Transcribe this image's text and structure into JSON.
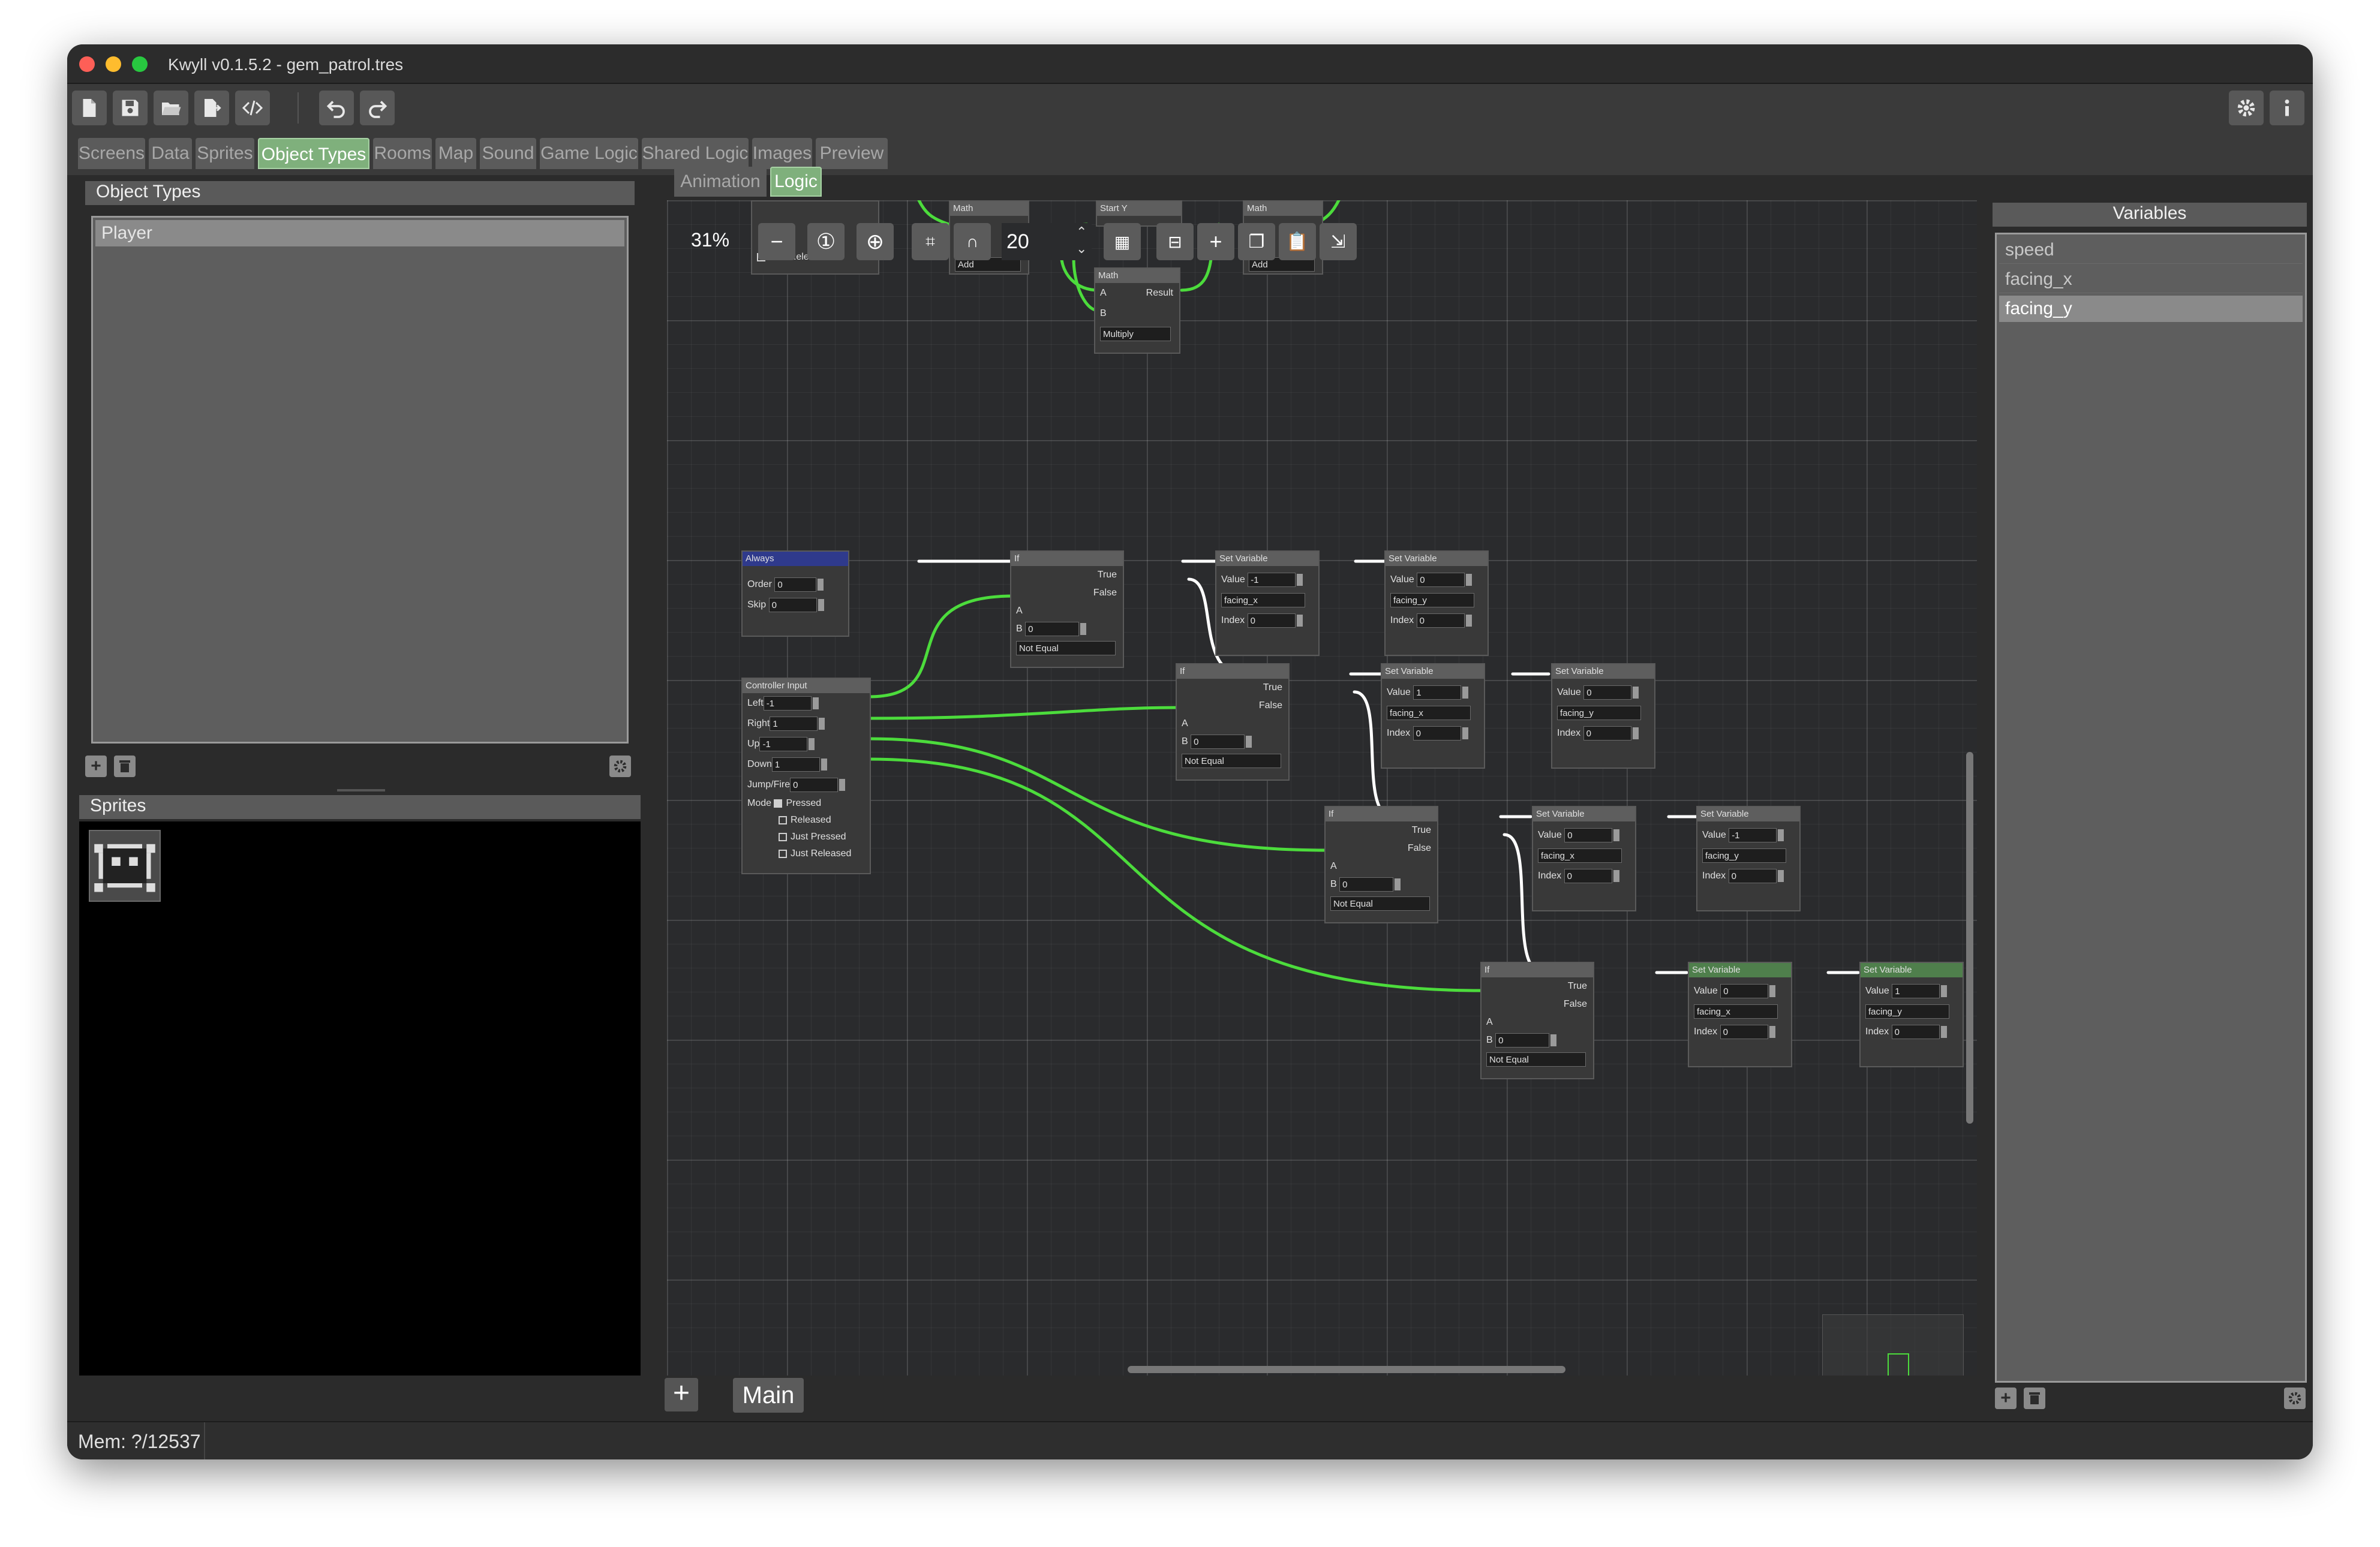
{
  "window": {
    "title": "Kwyll v0.1.5.2 - gem_patrol.tres"
  },
  "toolbar": {
    "left_buttons": [
      "new-file-icon",
      "save-icon",
      "open-folder-icon",
      "export-icon",
      "code-icon",
      "undo-icon",
      "redo-icon"
    ],
    "right_buttons": [
      "gear-icon",
      "info-icon"
    ]
  },
  "tabs": [
    "Screens",
    "Data",
    "Sprites",
    "Object Types",
    "Rooms",
    "Map",
    "Sound",
    "Game Logic",
    "Shared Logic",
    "Images",
    "Preview"
  ],
  "active_tab": "Object Types",
  "subtabs": [
    "Animation",
    "Logic"
  ],
  "active_subtab": "Logic",
  "left": {
    "object_types_header": "Object Types",
    "object_types": [
      "Player"
    ],
    "sprites_header": "Sprites"
  },
  "graph": {
    "zoom": "31%",
    "snap_value": "20",
    "bottom_tab": "Main",
    "add_label": "+",
    "nodes": {
      "top_cut": {
        "title": "Math",
        "math2": "Math",
        "start_y": "Start Y",
        "add1": "Add",
        "add2": "Add",
        "just_released": "Just Released",
        "mult_title": "Math",
        "a": "A",
        "b": "B",
        "result": "Result",
        "op": "Multiply"
      },
      "always": {
        "title": "Always",
        "order_label": "Order",
        "order": "0",
        "skip_label": "Skip",
        "skip": "0"
      },
      "controller": {
        "title": "Controller Input",
        "left_label": "Left",
        "left": "-1",
        "right_label": "Right",
        "right": "1",
        "up_label": "Up",
        "up": "-1",
        "down_label": "Down",
        "down": "1",
        "jump_label": "Jump/Fire",
        "jump": "0",
        "mode_label": "Mode",
        "pressed": "Pressed",
        "released": "Released",
        "just_pressed": "Just Pressed",
        "just_released": "Just Released"
      },
      "if_common": {
        "title": "If",
        "true": "True",
        "false": "False",
        "a": "A",
        "b": "B",
        "op": "Not Equal",
        "b_val": "0"
      },
      "setvar_common": {
        "title": "Set Variable",
        "value": "Value",
        "index": "Index"
      },
      "sv1": {
        "value": "-1",
        "var": "facing_x",
        "index": "0"
      },
      "sv2": {
        "value": "0",
        "var": "facing_y",
        "index": "0"
      },
      "sv3": {
        "value": "1",
        "var": "facing_x",
        "index": "0"
      },
      "sv4": {
        "value": "0",
        "var": "facing_y",
        "index": "0"
      },
      "sv5": {
        "value": "0",
        "var": "facing_x",
        "index": "0"
      },
      "sv6": {
        "value": "-1",
        "var": "facing_y",
        "index": "0"
      },
      "sv7": {
        "value": "0",
        "var": "facing_x",
        "index": "0"
      },
      "sv8": {
        "value": "1",
        "var": "facing_y",
        "index": "0"
      }
    }
  },
  "variables": {
    "header": "Variables",
    "items": [
      "speed",
      "facing_x",
      "facing_y"
    ],
    "selected": "facing_y"
  },
  "status": {
    "mem": "Mem: ?/12537"
  },
  "colors": {
    "accent_green": "#7fb07c",
    "wire_green": "#4cdc3c",
    "always_blue": "#2f3a8c"
  }
}
